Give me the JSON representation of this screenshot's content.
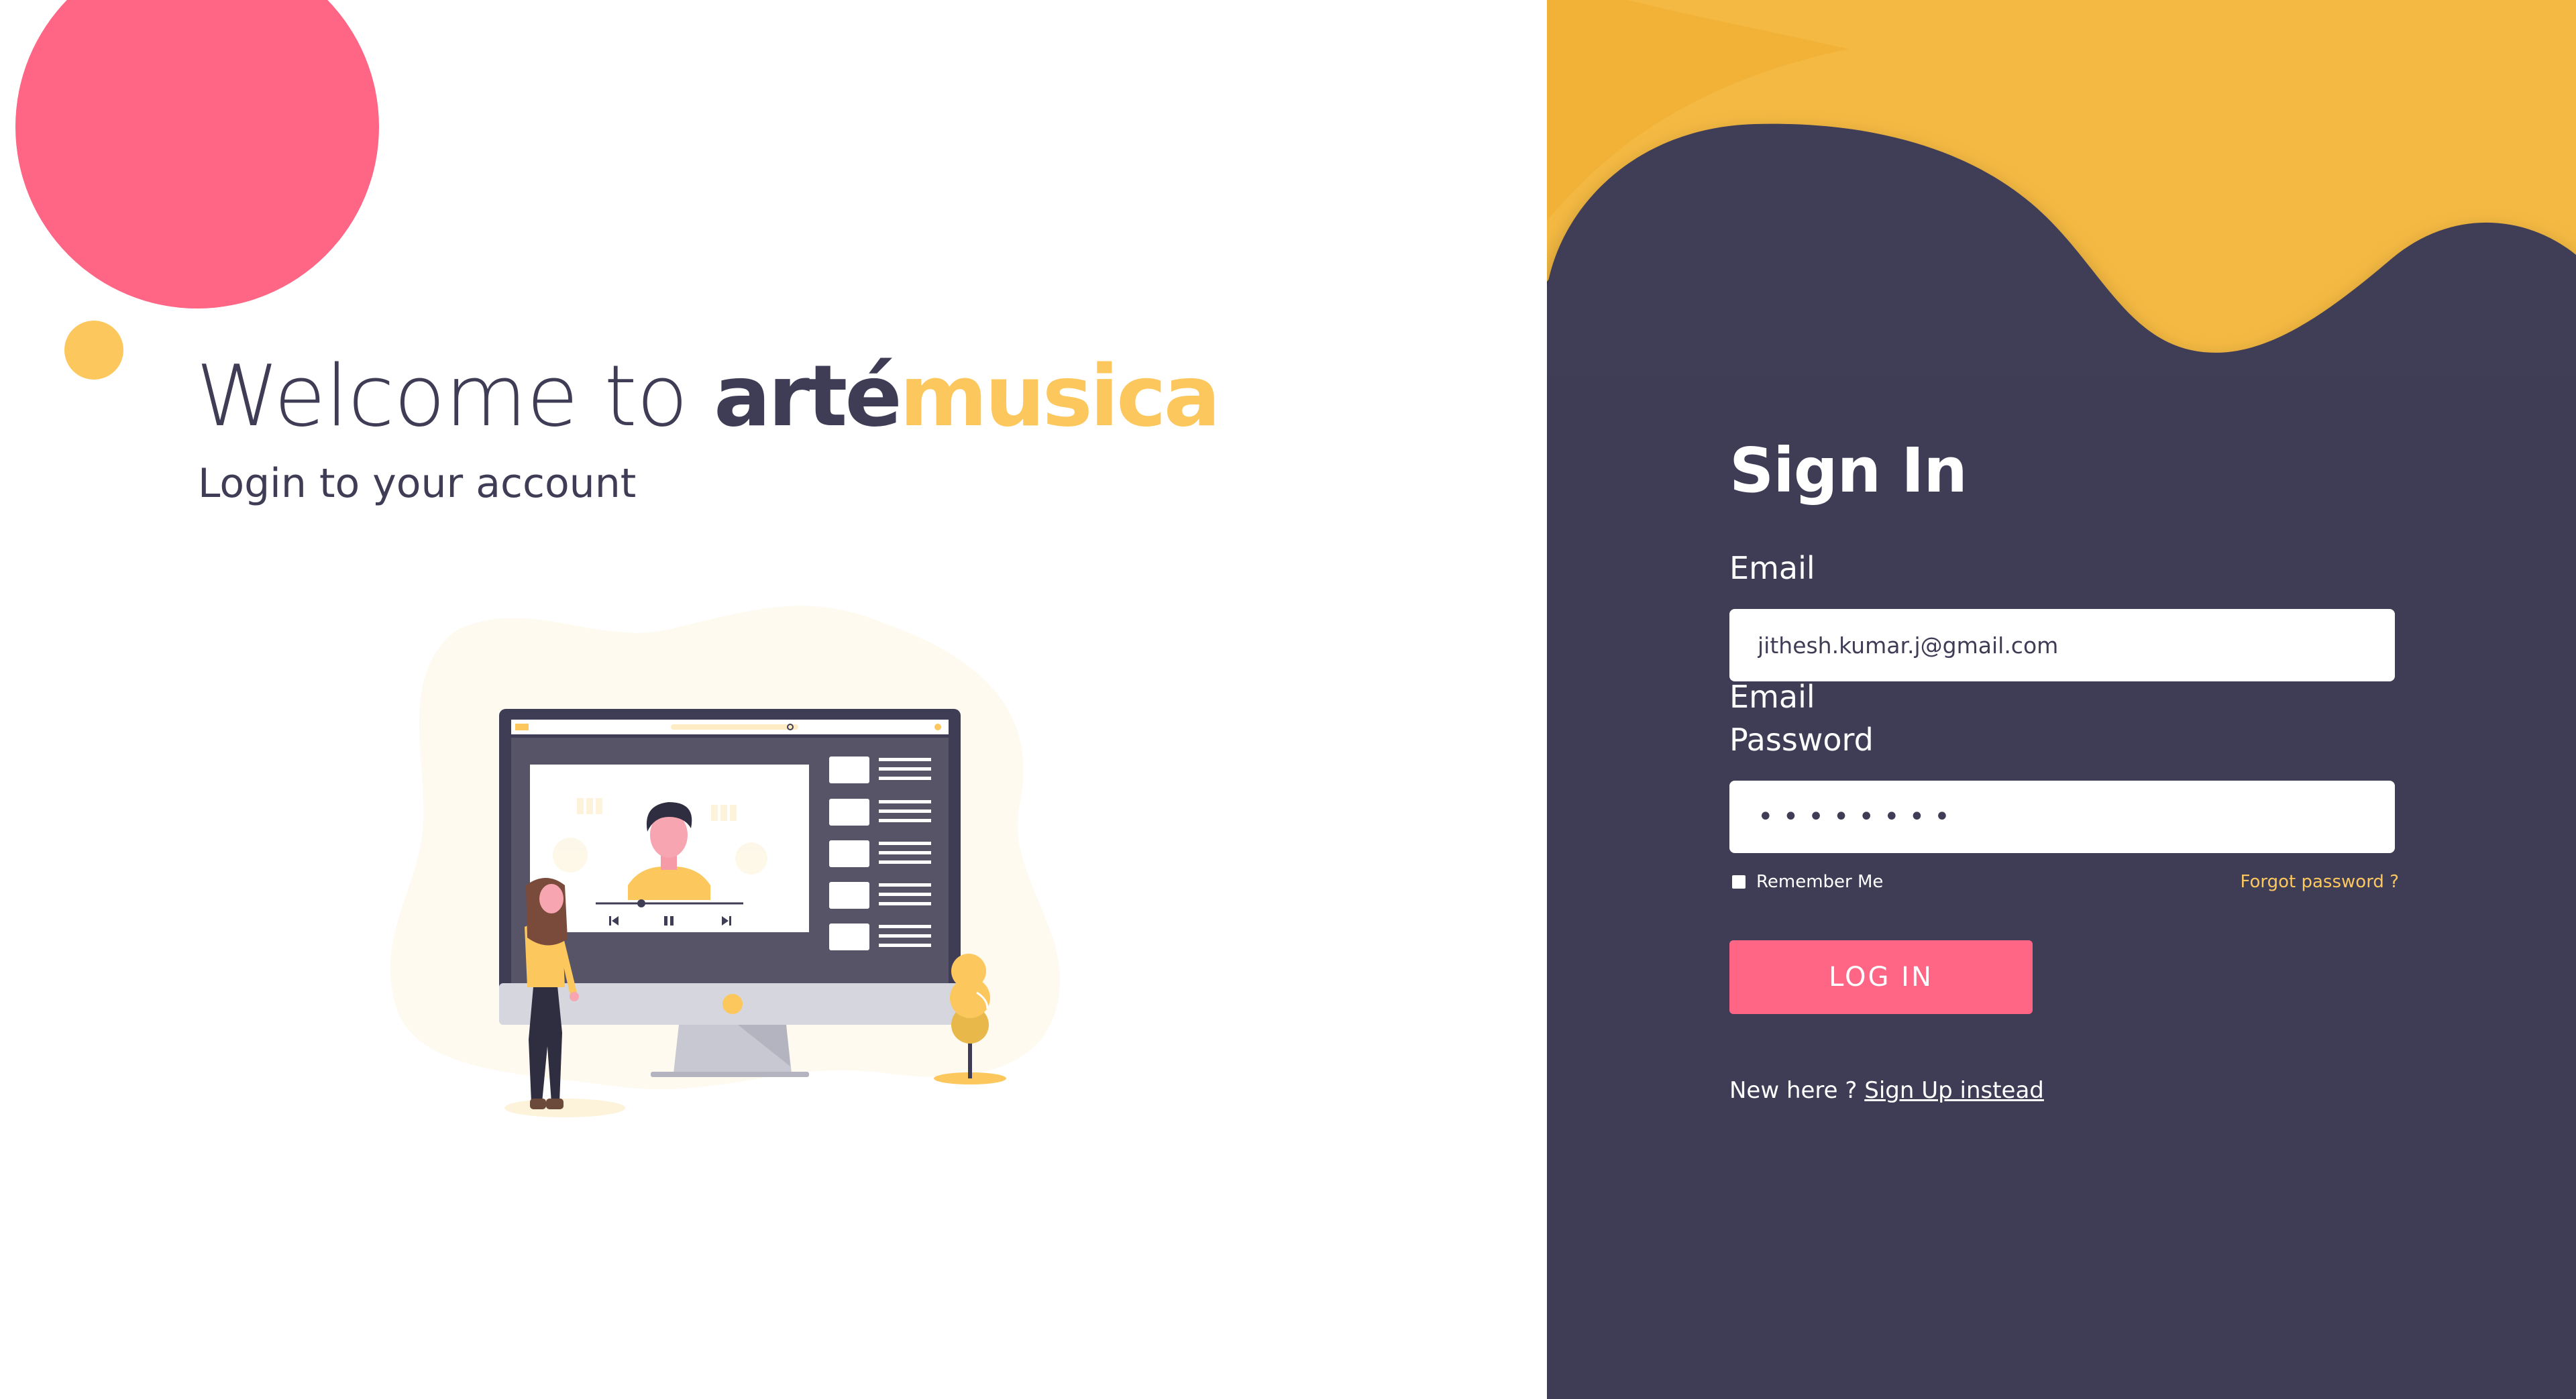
{
  "colors": {
    "accent_pink": "#ff6584",
    "accent_yellow": "#fcc85e",
    "dark": "#3f3d56",
    "white": "#ffffff"
  },
  "hero": {
    "welcome_prefix": "Welcome to ",
    "brand_part1": "arté",
    "brand_part2": "musica",
    "subtitle": "Login to your account"
  },
  "signin": {
    "title": "Sign In",
    "email_label": "Email",
    "email_value": "jithesh.kumar.j@gmail.com",
    "email_helper_label": "Email",
    "password_label": "Password",
    "password_value": "********",
    "remember_label": "Remember Me",
    "remember_checked": false,
    "forgot_label": "Forgot password ?",
    "login_button": "LOG IN",
    "new_here_text": "New here ? ",
    "signup_link": "Sign Up instead"
  },
  "icons": {
    "player_controls": [
      "skip-back-icon",
      "pause-icon",
      "skip-forward-icon"
    ],
    "search_icon": "search-icon"
  }
}
